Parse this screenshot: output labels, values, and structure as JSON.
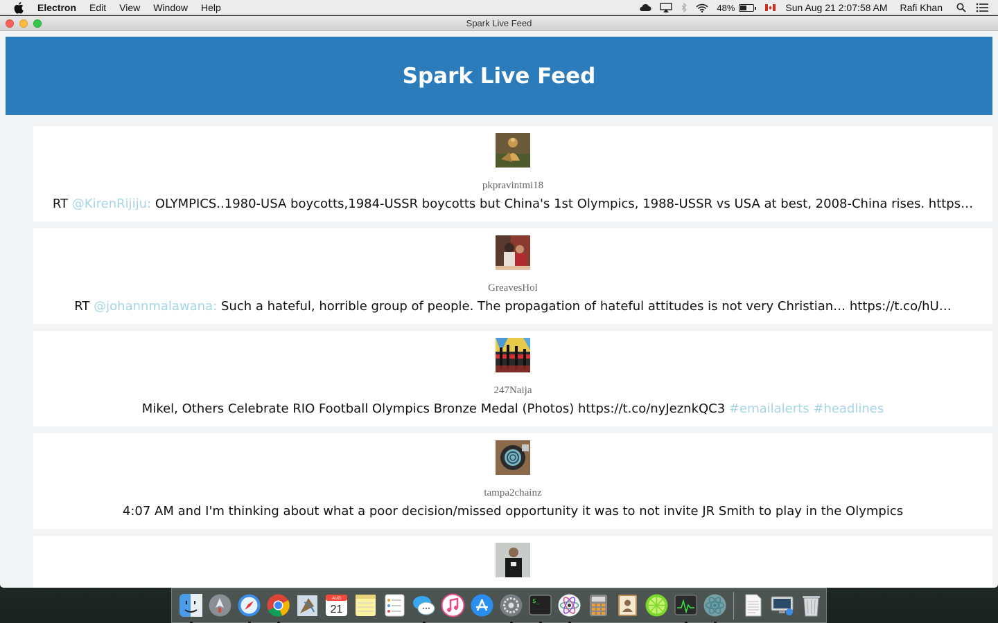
{
  "menubar": {
    "app_name": "Electron",
    "menus": [
      "Edit",
      "View",
      "Window",
      "Help"
    ],
    "battery_percent": "48%",
    "battery_level": 0.48,
    "clock": "Sun Aug 21  2:07:58 AM",
    "user": "Rafi Khan"
  },
  "window": {
    "title": "Spark Live Feed"
  },
  "header": {
    "title": "Spark Live Feed"
  },
  "feed": [
    {
      "username": "pkpravintmi18",
      "segments": [
        {
          "type": "text",
          "text": "RT "
        },
        {
          "type": "mention",
          "text": "@KirenRijiju:"
        },
        {
          "type": "text",
          "text": " OLYMPICS..1980-USA boycotts,1984-USSR boycotts but China's 1st Olympics, 1988-USSR vs USA at best, 2008-China rises. https…"
        }
      ]
    },
    {
      "username": "GreavesHol",
      "segments": [
        {
          "type": "text",
          "text": "RT "
        },
        {
          "type": "mention",
          "text": "@johannmalawana:"
        },
        {
          "type": "text",
          "text": " Such a hateful, horrible group of people. The propagation of hateful attitudes is not very Christian… https://t.co/hU…"
        }
      ]
    },
    {
      "username": "247Naija",
      "segments": [
        {
          "type": "text",
          "text": "Mikel, Others Celebrate RIO Football Olympics Bronze Medal (Photos) https://t.co/nyJeznkQC3 "
        },
        {
          "type": "hashtag",
          "text": "#emailalerts"
        },
        {
          "type": "text",
          "text": " "
        },
        {
          "type": "hashtag",
          "text": "#headlines"
        }
      ]
    },
    {
      "username": "tampa2chainz",
      "segments": [
        {
          "type": "text",
          "text": "4:07 AM and I'm thinking about what a poor decision/missed opportunity it was to not invite JR Smith to play in the Olympics"
        }
      ]
    },
    {
      "username": "",
      "segments": []
    }
  ],
  "calendar_icon": {
    "month": "AUG",
    "day": "21"
  },
  "dock": [
    "finder-icon",
    "launchpad-icon",
    "safari-icon",
    "chrome-icon",
    "mail-icon",
    "calendar-icon",
    "notes-icon",
    "reminders-icon",
    "messages-icon",
    "itunes-icon",
    "app-store-icon",
    "system-preferences-icon",
    "terminal-icon",
    "atom-icon",
    "calculator-icon",
    "contacts-icon",
    "lime-icon",
    "activity-monitor-icon",
    "electron-icon",
    "document-icon",
    "remote-desktop-icon",
    "trash-icon"
  ],
  "colors": {
    "header_bg": "#2c7bba",
    "link": "#a6d5e5"
  }
}
